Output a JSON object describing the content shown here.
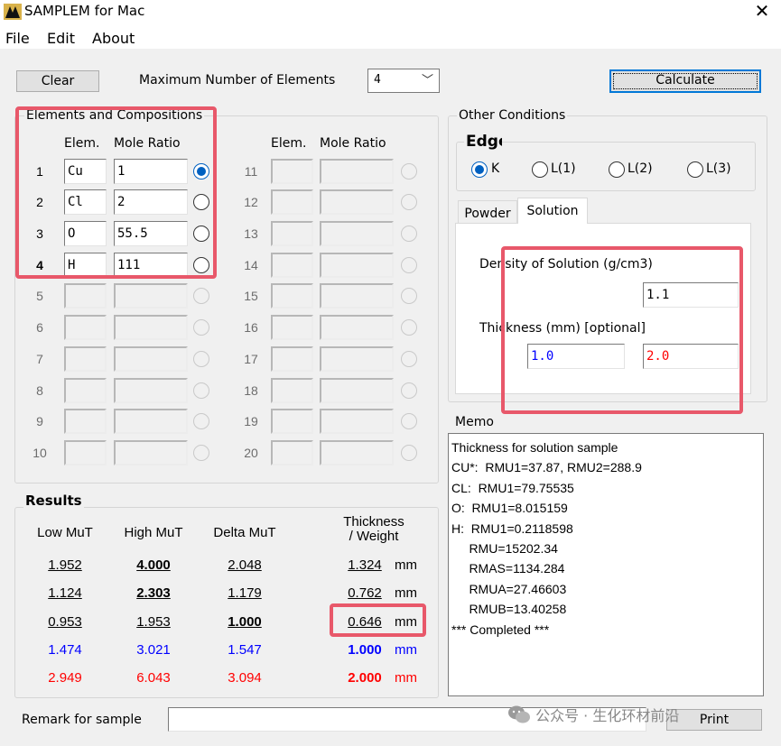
{
  "window": {
    "title": "SAMPLEM for Mac",
    "close_glyph": "✕"
  },
  "menu": [
    "File",
    "Edit",
    "About"
  ],
  "toolbar": {
    "clear_label": "Clear",
    "max_elements_label": "Maximum Number of Elements",
    "max_elements_value": "4",
    "calculate_label": "Calculate"
  },
  "elements": {
    "group_label": "Elements and Compositions",
    "col_elem": "Elem.",
    "col_ratio": "Mole Ratio",
    "rows": [
      {
        "n": "1",
        "elem": "Cu",
        "ratio": "1",
        "selected": true
      },
      {
        "n": "2",
        "elem": "Cl",
        "ratio": "2",
        "selected": false
      },
      {
        "n": "3",
        "elem": "O",
        "ratio": "55.5",
        "selected": false
      },
      {
        "n": "4",
        "elem": "H",
        "ratio": "111",
        "selected": false
      },
      {
        "n": "5",
        "elem": "",
        "ratio": ""
      },
      {
        "n": "6",
        "elem": "",
        "ratio": ""
      },
      {
        "n": "7",
        "elem": "",
        "ratio": ""
      },
      {
        "n": "8",
        "elem": "",
        "ratio": ""
      },
      {
        "n": "9",
        "elem": "",
        "ratio": ""
      },
      {
        "n": "10",
        "elem": "",
        "ratio": ""
      },
      {
        "n": "11",
        "elem": "",
        "ratio": ""
      },
      {
        "n": "12",
        "elem": "",
        "ratio": ""
      },
      {
        "n": "13",
        "elem": "",
        "ratio": ""
      },
      {
        "n": "14",
        "elem": "",
        "ratio": ""
      },
      {
        "n": "15",
        "elem": "",
        "ratio": ""
      },
      {
        "n": "16",
        "elem": "",
        "ratio": ""
      },
      {
        "n": "17",
        "elem": "",
        "ratio": ""
      },
      {
        "n": "18",
        "elem": "",
        "ratio": ""
      },
      {
        "n": "19",
        "elem": "",
        "ratio": ""
      },
      {
        "n": "20",
        "elem": "",
        "ratio": ""
      }
    ]
  },
  "other_conditions": {
    "group_label": "Other Conditions",
    "edge_label": "Edge",
    "edges": [
      "K",
      "L(1)",
      "L(2)",
      "L(3)"
    ],
    "edge_selected": "K",
    "tabs": [
      "Powder",
      "Solution"
    ],
    "active_tab": "Solution",
    "density_label": "Density of Solution (g/cm3)",
    "density_value": "1.1",
    "thickness_label": "Thickness (mm) [optional]",
    "thickness_1": "1.0",
    "thickness_2": "2.0"
  },
  "results": {
    "group_label": "Results",
    "headers": [
      "Low MuT",
      "High MuT",
      "Delta MuT",
      "Thickness",
      "/ Weight"
    ],
    "unit": "mm",
    "rows": [
      [
        "1.952",
        "4.000",
        "2.048",
        "1.324"
      ],
      [
        "1.124",
        "2.303",
        "1.179",
        "0.762"
      ],
      [
        "0.953",
        "1.953",
        "1.000",
        "0.646"
      ],
      [
        "1.474",
        "3.021",
        "1.547",
        "1.000"
      ],
      [
        "2.949",
        "6.043",
        "3.094",
        "2.000"
      ]
    ]
  },
  "memo": {
    "label": "Memo",
    "lines": [
      "Thickness for solution sample",
      "CU*:  RMU1=37.87, RMU2=288.9",
      "CL:  RMU1=79.75535",
      "O:  RMU1=8.015159",
      "H:  RMU1=0.2118598",
      "     RMU=15202.34",
      "     RMAS=1134.284",
      "     RMUA=27.46603",
      "     RMUB=13.40258",
      "*** Completed ***"
    ]
  },
  "remark": {
    "label": "Remark for sample",
    "value": "",
    "print_label": "Print"
  },
  "watermark": "公众号 · 生化环材前沿",
  "colors": {
    "highlight": "#e8586a",
    "blue": "#0000ff",
    "red": "#ff0000",
    "accent": "#0078d7"
  }
}
